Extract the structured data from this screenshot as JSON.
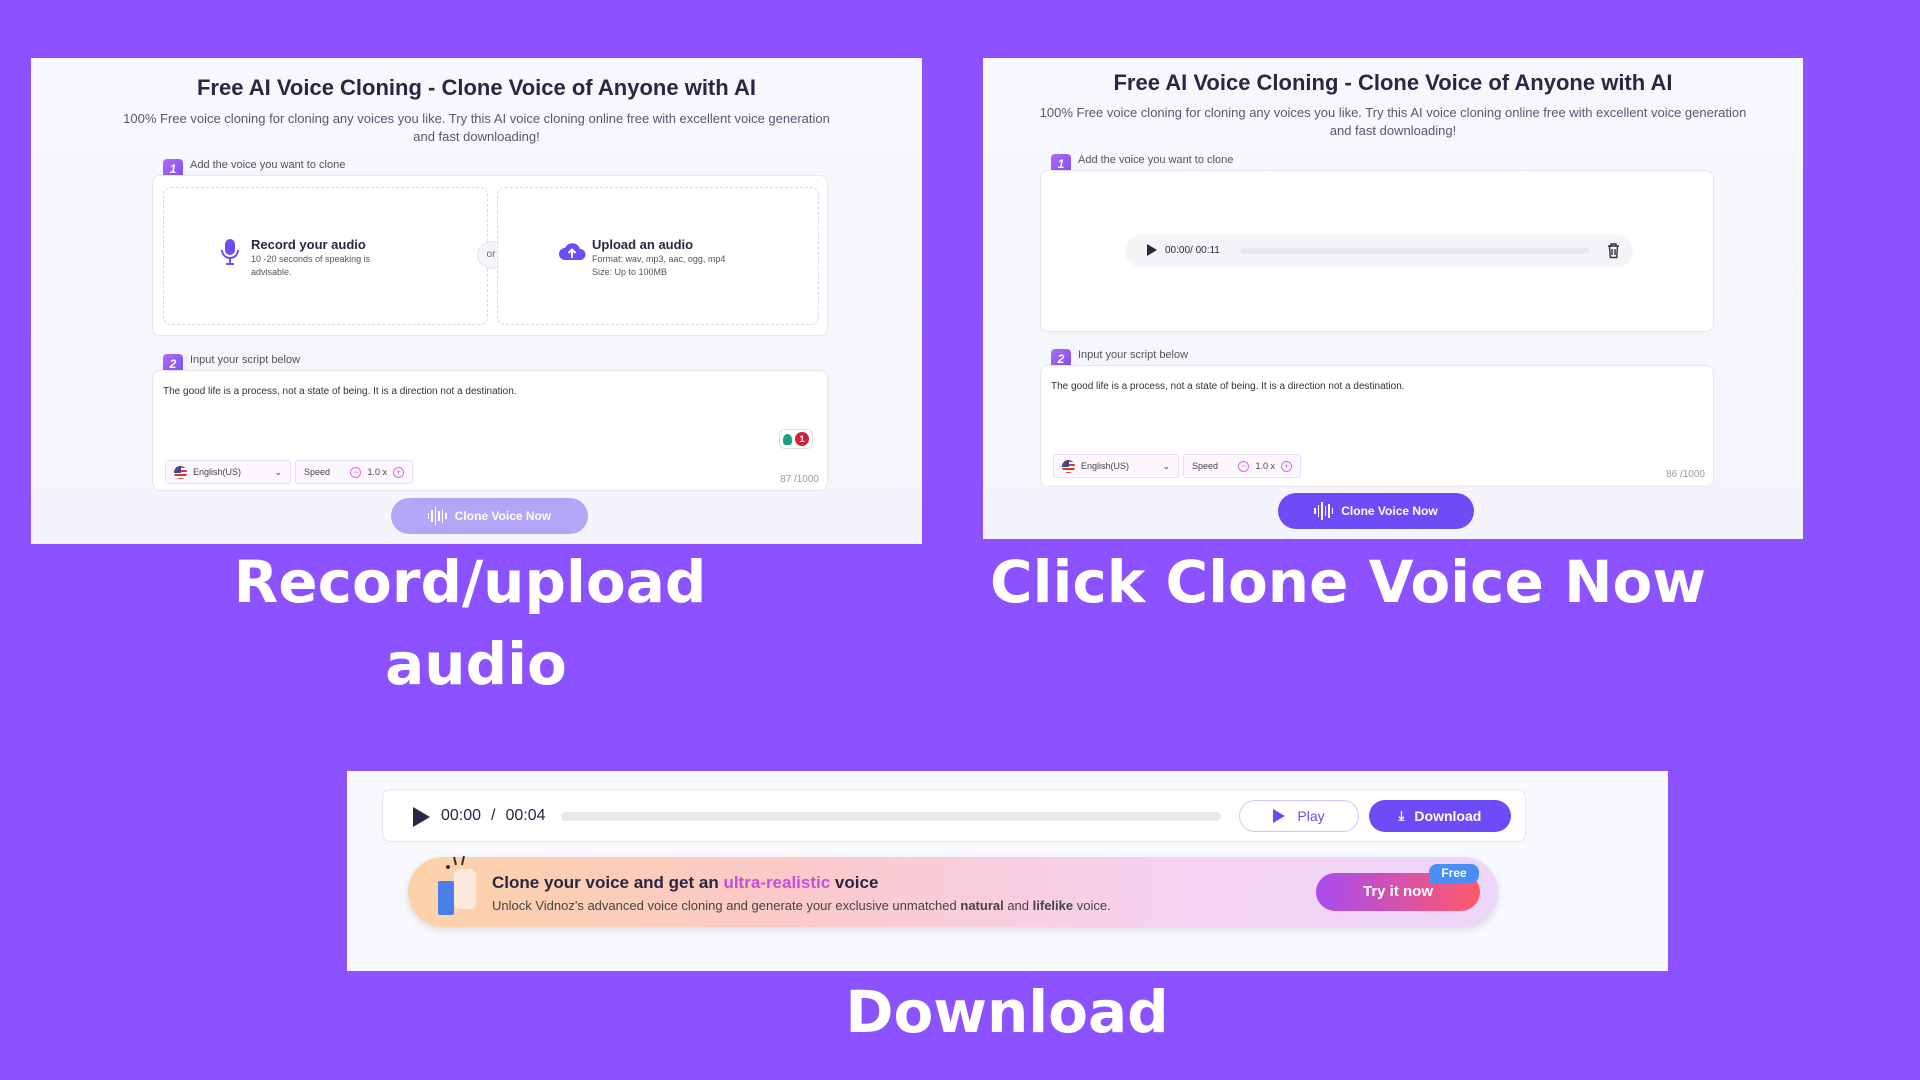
{
  "background_color": "#8c52ff",
  "accent_color": "#6b4cf6",
  "common": {
    "title": "Free AI Voice Cloning - Clone Voice of Anyone with AI",
    "subtitle_line1": "100% Free voice cloning for cloning any voices you like. Try this AI voice cloning online free with excellent voice generation",
    "subtitle_line2": "and fast downloading!",
    "step1_num": "1",
    "step1_label": "Add the voice you want to clone",
    "step2_num": "2",
    "step2_label": "Input your script below",
    "script_text": "The good life is a process, not a state of being. It is a direction not a destination.",
    "language": "English(US)",
    "speed_label": "Speed",
    "speed_value": "1.0 x",
    "minus": "−",
    "plus": "+",
    "clone_button": "Clone Voice Now"
  },
  "panel1": {
    "record_title": "Record your audio",
    "record_desc": "10 -20 seconds of speaking is advisable.",
    "or": "or",
    "upload_title": "Upload an audio",
    "upload_format": "Format: wav, mp3, aac, ogg, mp4",
    "upload_size": "Size: Up to 100MB",
    "grammar_count": "1",
    "char_count": "87 /1000",
    "caption_line1": "Record/upload",
    "caption_line2": "audio"
  },
  "panel2": {
    "audio_time": "00:00/ 00:11",
    "audio_progress": 0,
    "char_count": "86 /1000",
    "caption": "Click Clone Voice Now"
  },
  "panel3": {
    "current_time": "00:00",
    "separator": "/",
    "duration": "00:04",
    "progress": 0,
    "play_button": "Play",
    "download_button": "Download",
    "promo_title_pre": "Clone your voice and get an ",
    "promo_title_hl": "ultra-realistic",
    "promo_title_post": " voice",
    "promo_desc_pre": "Unlock Vidnoz's advanced voice cloning and generate your exclusive unmatched ",
    "promo_bold1": "natural",
    "promo_mid": " and ",
    "promo_bold2": "lifelike",
    "promo_end": " voice.",
    "try_button": "Try it now",
    "free_badge": "Free",
    "caption": "Download"
  }
}
